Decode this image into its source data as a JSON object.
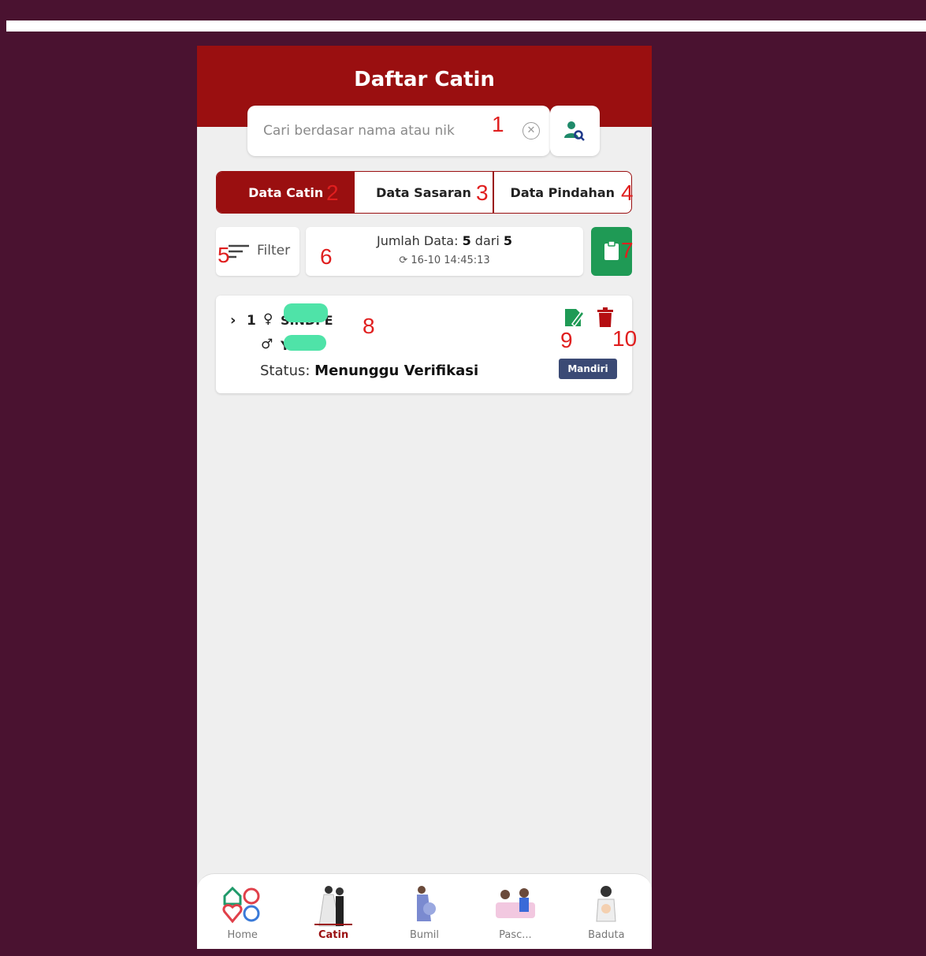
{
  "header": {
    "title": "Daftar Catin"
  },
  "search": {
    "placeholder": "Cari berdasar nama atau nik"
  },
  "tabs": [
    {
      "label": "Data Catin",
      "active": true
    },
    {
      "label": "Data Sasaran",
      "active": false
    },
    {
      "label": "Data Pindahan",
      "active": false
    }
  ],
  "filter": {
    "label": "Filter"
  },
  "info": {
    "jumlah_prefix": "Jumlah Data: ",
    "count": "5",
    "dari": " dari ",
    "total": "5",
    "sync_icon": "refresh-icon",
    "timestamp": "16-10 14:45:13"
  },
  "card": {
    "number": "1",
    "female_name": "SINDI E",
    "male_name": "Y",
    "status_label": "Status: ",
    "status_value": "Menunggu Verifikasi",
    "badge": "Mandiri"
  },
  "markers": [
    "1",
    "2",
    "3",
    "4",
    "5",
    "6",
    "7",
    "8",
    "9",
    "10"
  ],
  "bottom_nav": [
    {
      "label": "Home",
      "active": false,
      "icon": "home-icon"
    },
    {
      "label": "Catin",
      "active": true,
      "icon": "couple-icon"
    },
    {
      "label": "Bumil",
      "active": false,
      "icon": "pregnant-icon"
    },
    {
      "label": "Pasc...",
      "active": false,
      "icon": "postpartum-icon"
    },
    {
      "label": "Baduta",
      "active": false,
      "icon": "baby-icon"
    }
  ],
  "colors": {
    "background": "#4a1230",
    "header": "#9a0f10",
    "accent_green": "#1f9a55",
    "badge": "#3b4a75",
    "marker": "#e01f1f",
    "mask": "#4fe3a8"
  }
}
